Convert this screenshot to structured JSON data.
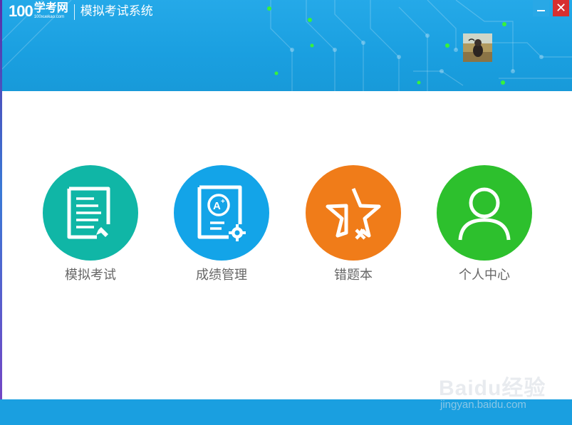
{
  "window": {
    "logo_number": "100",
    "logo_brand": "学考网",
    "logo_domain": "100xuekao.com",
    "title": "模拟考试系统"
  },
  "controls": {
    "minimize_icon": "minimize-icon",
    "close_icon": "close-icon",
    "close_glyph": "✕"
  },
  "tiles": [
    {
      "label": "模拟考试",
      "color": "#10b6a6",
      "icon": "exam-paper-icon"
    },
    {
      "label": "成绩管理",
      "color": "#13a4e8",
      "icon": "grade-report-icon"
    },
    {
      "label": "错题本",
      "color": "#f07c19",
      "icon": "star-wrong-icon"
    },
    {
      "label": "个人中心",
      "color": "#2dc02d",
      "icon": "user-profile-icon"
    }
  ],
  "watermark": {
    "brand": "Baidu经验",
    "url": "jingyan.baidu.com"
  }
}
